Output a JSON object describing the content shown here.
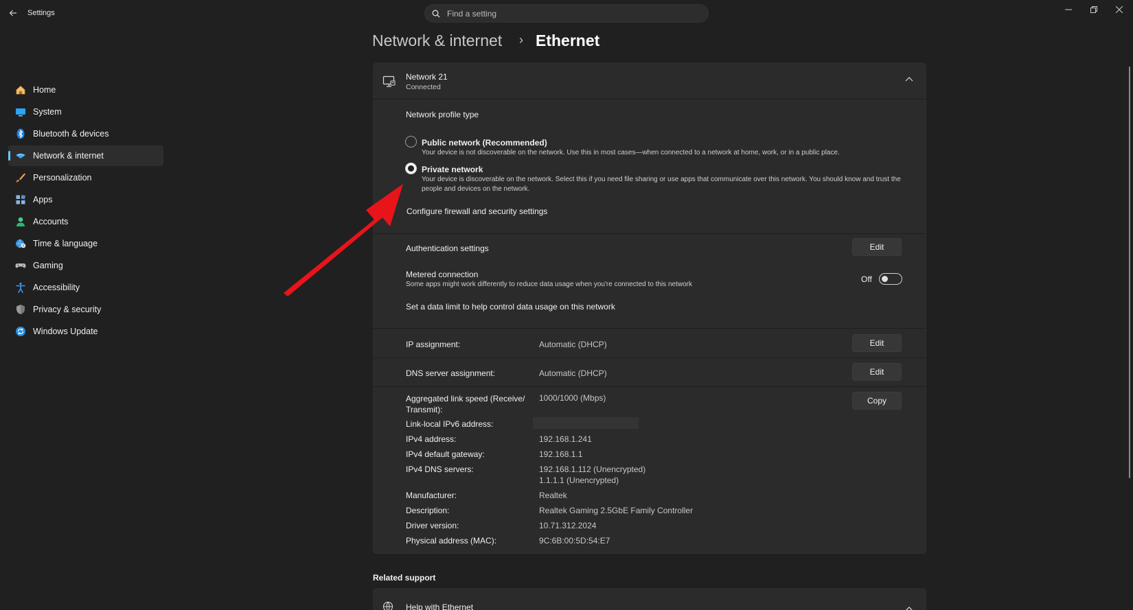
{
  "app": {
    "title": "Settings"
  },
  "search": {
    "placeholder": "Find a setting"
  },
  "sidebar": {
    "items": [
      {
        "label": "Home",
        "icon": "home-icon"
      },
      {
        "label": "System",
        "icon": "system-icon"
      },
      {
        "label": "Bluetooth & devices",
        "icon": "bluetooth-icon"
      },
      {
        "label": "Network & internet",
        "icon": "network-icon",
        "active": true
      },
      {
        "label": "Personalization",
        "icon": "brush-icon"
      },
      {
        "label": "Apps",
        "icon": "apps-icon"
      },
      {
        "label": "Accounts",
        "icon": "accounts-icon"
      },
      {
        "label": "Time & language",
        "icon": "globe-clock-icon"
      },
      {
        "label": "Gaming",
        "icon": "gamepad-icon"
      },
      {
        "label": "Accessibility",
        "icon": "accessibility-icon"
      },
      {
        "label": "Privacy & security",
        "icon": "shield-icon"
      },
      {
        "label": "Windows Update",
        "icon": "update-icon"
      }
    ]
  },
  "breadcrumb": {
    "parent": "Network & internet",
    "separator": "›",
    "current": "Ethernet"
  },
  "network": {
    "name": "Network 21",
    "status": "Connected",
    "profile_heading": "Network profile type",
    "public_label": "Public network (Recommended)",
    "public_desc": "Your device is not discoverable on the network. Use this in most cases—when connected to a network at home, work, or in a public place.",
    "private_label": "Private network",
    "private_desc": "Your device is discoverable on the network. Select this if you need file sharing or use apps that communicate over this network. You should know and trust the people and devices on the network.",
    "selected_profile": "private",
    "firewall_link": "Configure firewall and security settings",
    "auth_label": "Authentication settings",
    "edit_label": "Edit",
    "copy_label": "Copy",
    "metered_label": "Metered connection",
    "metered_desc": "Some apps might work differently to reduce data usage when you're connected to this network",
    "metered_state": "Off",
    "data_limit_link": "Set a data limit to help control data usage on this network",
    "ip_assignment_label": "IP assignment:",
    "ip_assignment_value": "Automatic (DHCP)",
    "dns_assignment_label": "DNS server assignment:",
    "dns_assignment_value": "Automatic (DHCP)",
    "properties": {
      "link_speed_label": "Aggregated link speed (Receive/ Transmit):",
      "link_speed_value": "1000/1000 (Mbps)",
      "ipv6_label": "Link-local IPv6 address:",
      "ipv4_label": "IPv4 address:",
      "ipv4_value": "192.168.1.241",
      "gateway_label": "IPv4 default gateway:",
      "gateway_value": "192.168.1.1",
      "dns_label": "IPv4 DNS servers:",
      "dns_value_1": "192.168.1.112 (Unencrypted)",
      "dns_value_2": "1.1.1.1 (Unencrypted)",
      "manufacturer_label": "Manufacturer:",
      "manufacturer_value": "Realtek",
      "description_label": "Description:",
      "description_value": "Realtek Gaming 2.5GbE Family Controller",
      "driver_label": "Driver version:",
      "driver_value": "10.71.312.2024",
      "mac_label": "Physical address (MAC):",
      "mac_value": "9C:6B:00:5D:54:E7"
    }
  },
  "related": {
    "heading": "Related support",
    "help_label": "Help with Ethernet"
  },
  "colors": {
    "accent": "#60cdff",
    "background": "#202020",
    "card": "#2b2b2b",
    "arrow": "#e8141a"
  }
}
